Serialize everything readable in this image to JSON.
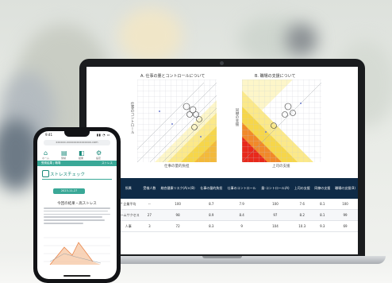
{
  "laptop": {
    "chart_a_title": "A. 仕事の量とコントロールについて",
    "chart_a_ylabel": "仕事のコントロール",
    "chart_a_xlabel": "仕事の量的負担",
    "chart_b_title": "B. 職場の支援について",
    "chart_b_ylabel": "同僚の支援",
    "chart_b_xlabel": "上司の支援",
    "table": {
      "headers": [
        "",
        "部署",
        "所属",
        "受検人数",
        "総合健康リスク(A)×(B)",
        "仕事の量的負担",
        "仕事のコントロール",
        "量-コントロール(A)",
        "上司の支援",
        "同僚の支援",
        "職場の支援(B)"
      ],
      "rows": [
        [
          "",
          "--",
          "* 企業平均",
          "--",
          "100",
          "8.7",
          "7.9",
          "100",
          "7.6",
          "8.1",
          "100"
        ],
        [
          "",
          "--",
          "チームサクセス",
          "27",
          "98",
          "8.9",
          "8.4",
          "97",
          "8.2",
          "8.1",
          "99"
        ],
        [
          "",
          "--",
          "人事",
          "3",
          "72",
          "8.3",
          "9",
          "104",
          "10.3",
          "9.3",
          "69"
        ]
      ]
    },
    "colors": {
      "table_header": "#0f2b47",
      "hot_red": "#e8291c",
      "warm_yellow": "#f6d64a"
    }
  },
  "phone": {
    "time": "9:41",
    "url": "xxxxxx.xxxxxxxxxxxxxxx.com",
    "nav": [
      "ホーム",
      "受検",
      "結果",
      "設定"
    ],
    "bar_left": "受検結果 | 職場",
    "bar_right": "ストレス",
    "section_title": "ストレスチェック",
    "date_button": "2023-11-27",
    "result_title": "今回の結果・高ストレス"
  }
}
